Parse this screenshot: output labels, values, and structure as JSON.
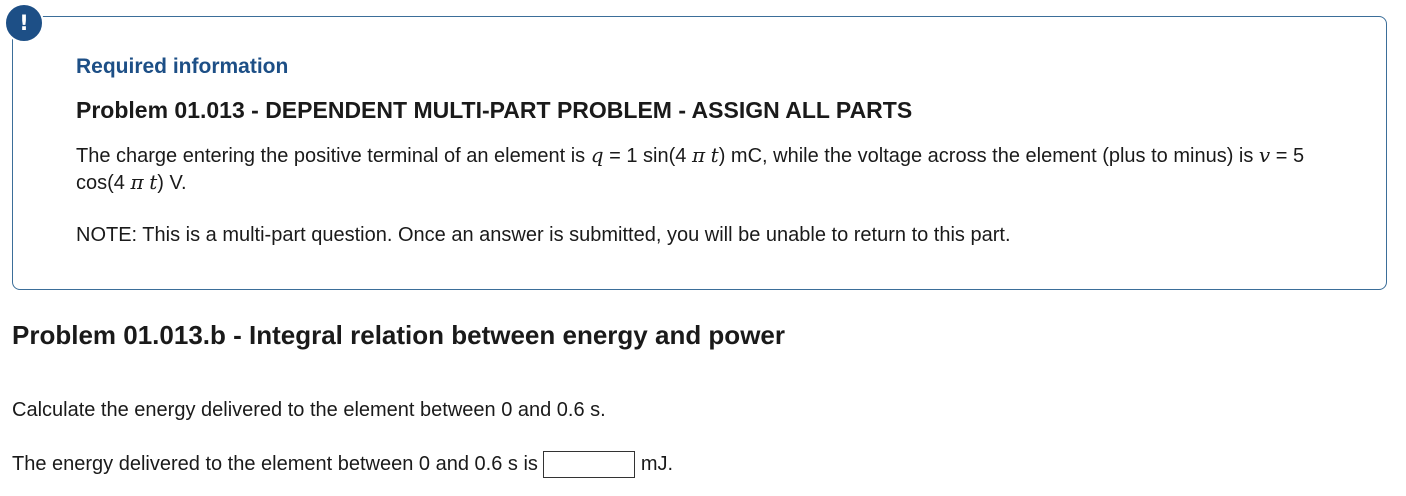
{
  "alert": {
    "icon": "exclamation-icon",
    "glyph": "!",
    "color": "#1d4f86"
  },
  "info_box": {
    "heading": "Required information",
    "title": "Problem 01.013 - DEPENDENT MULTI-PART PROBLEM - ASSIGN ALL PARTS",
    "statement": {
      "part1": "The charge entering the positive terminal of an element is ",
      "var_q": "q",
      "part2": " = 1 sin(4 ",
      "pi1": "π",
      "t1": "t",
      "part3": ") mC, while the voltage across the element (plus to minus) is ",
      "var_v": "v",
      "part4": " = 5 cos(4 ",
      "pi2": "π",
      "t2": "t",
      "part5": ") V."
    },
    "note": "NOTE: This is a multi-part question. Once an answer is submitted, you will be unable to return to this part.",
    "border_color": "#3b6e99"
  },
  "part": {
    "title": "Problem 01.013.b - Integral relation between energy and power",
    "question": "Calculate the energy delivered to the element between 0 and 0.6 s.",
    "answer_prefix": "The energy delivered to the element between 0 and 0.6 s is",
    "answer_value": "",
    "answer_unit": "mJ."
  }
}
